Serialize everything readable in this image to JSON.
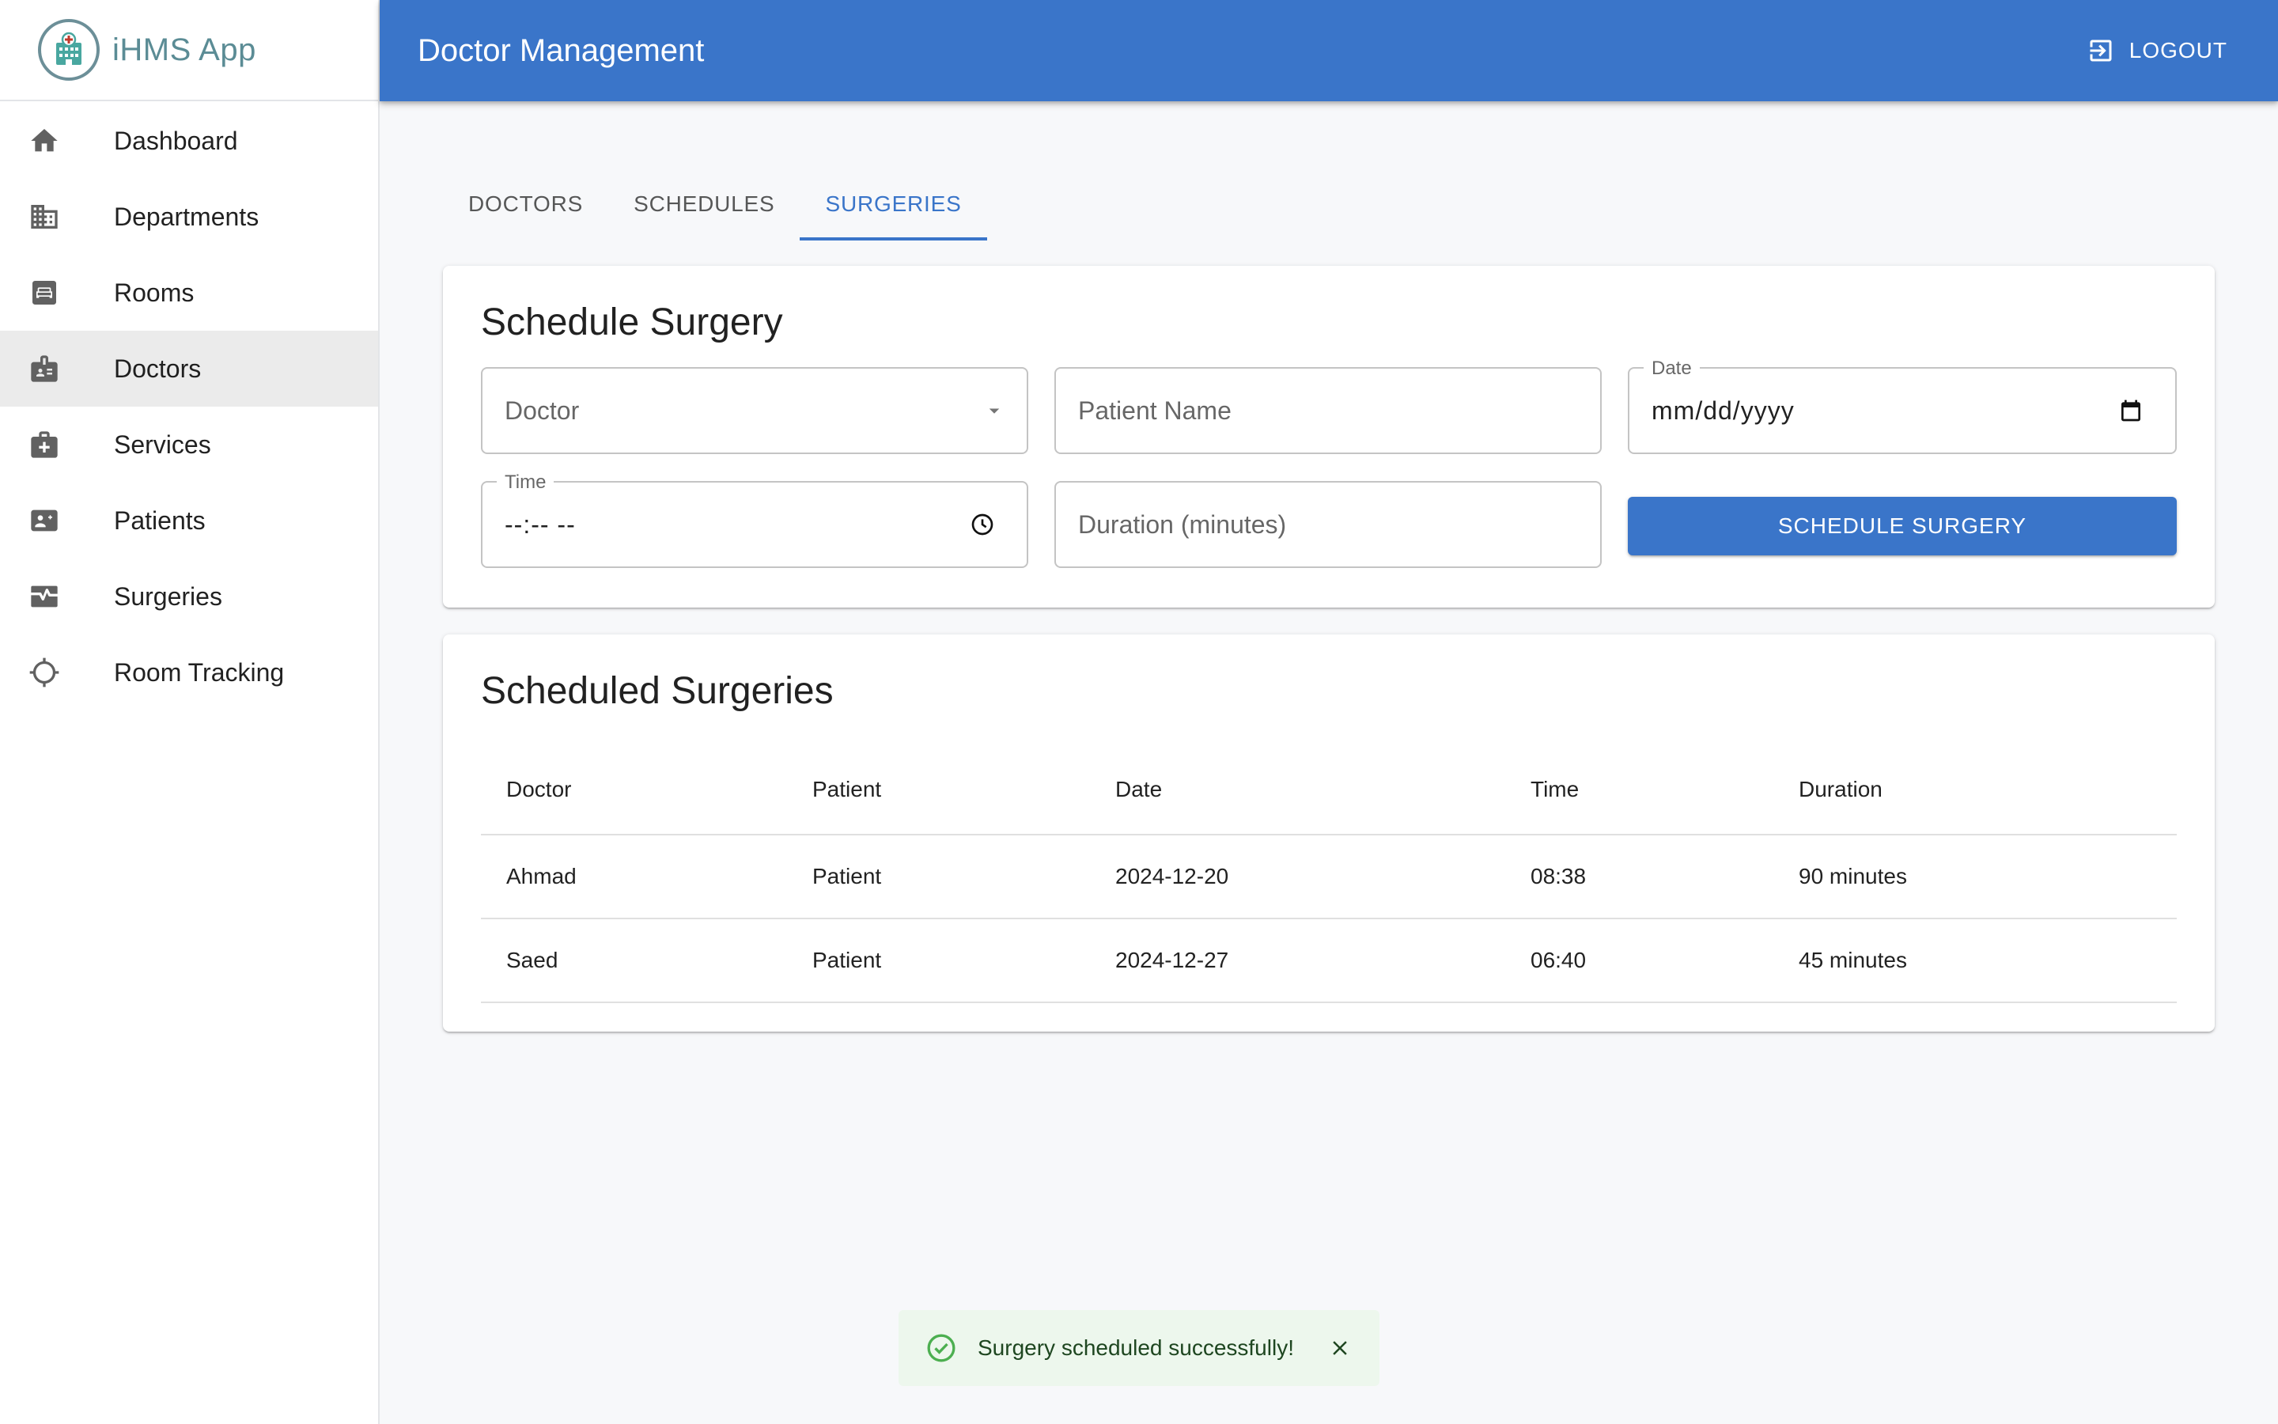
{
  "app": {
    "brand_name": "iHMS App",
    "page_title": "Doctor Management",
    "logout_label": "LOGOUT"
  },
  "sidebar": {
    "items": [
      {
        "label": "Dashboard",
        "icon": "home-icon"
      },
      {
        "label": "Departments",
        "icon": "building-icon"
      },
      {
        "label": "Rooms",
        "icon": "bed-icon"
      },
      {
        "label": "Doctors",
        "icon": "badge-icon",
        "active": true
      },
      {
        "label": "Services",
        "icon": "medical-kit-icon"
      },
      {
        "label": "Patients",
        "icon": "patient-card-icon"
      },
      {
        "label": "Surgeries",
        "icon": "monitor-heart-icon"
      },
      {
        "label": "Room Tracking",
        "icon": "crosshair-icon"
      }
    ]
  },
  "tabs": [
    {
      "label": "DOCTORS"
    },
    {
      "label": "SCHEDULES"
    },
    {
      "label": "SURGERIES",
      "active": true
    }
  ],
  "form": {
    "title": "Schedule Surgery",
    "doctor_placeholder": "Doctor",
    "patient_placeholder": "Patient Name",
    "date_label": "Date",
    "date_value": "mm/dd/yyyy",
    "time_label": "Time",
    "time_value": "--:-- --",
    "duration_placeholder": "Duration (minutes)",
    "submit_label": "SCHEDULE SURGERY"
  },
  "table": {
    "title": "Scheduled Surgeries",
    "columns": [
      "Doctor",
      "Patient",
      "Date",
      "Time",
      "Duration"
    ],
    "rows": [
      [
        "Ahmad",
        "Patient",
        "2024-12-20",
        "08:38",
        "90 minutes"
      ],
      [
        "Saed",
        "Patient",
        "2024-12-27",
        "06:40",
        "45 minutes"
      ]
    ]
  },
  "snackbar": {
    "message": "Surgery scheduled successfully!"
  },
  "colors": {
    "primary": "#3a75c9",
    "brand_text": "#5b8c95",
    "success_bg": "#edf7ed",
    "success_icon": "#4caf50"
  }
}
